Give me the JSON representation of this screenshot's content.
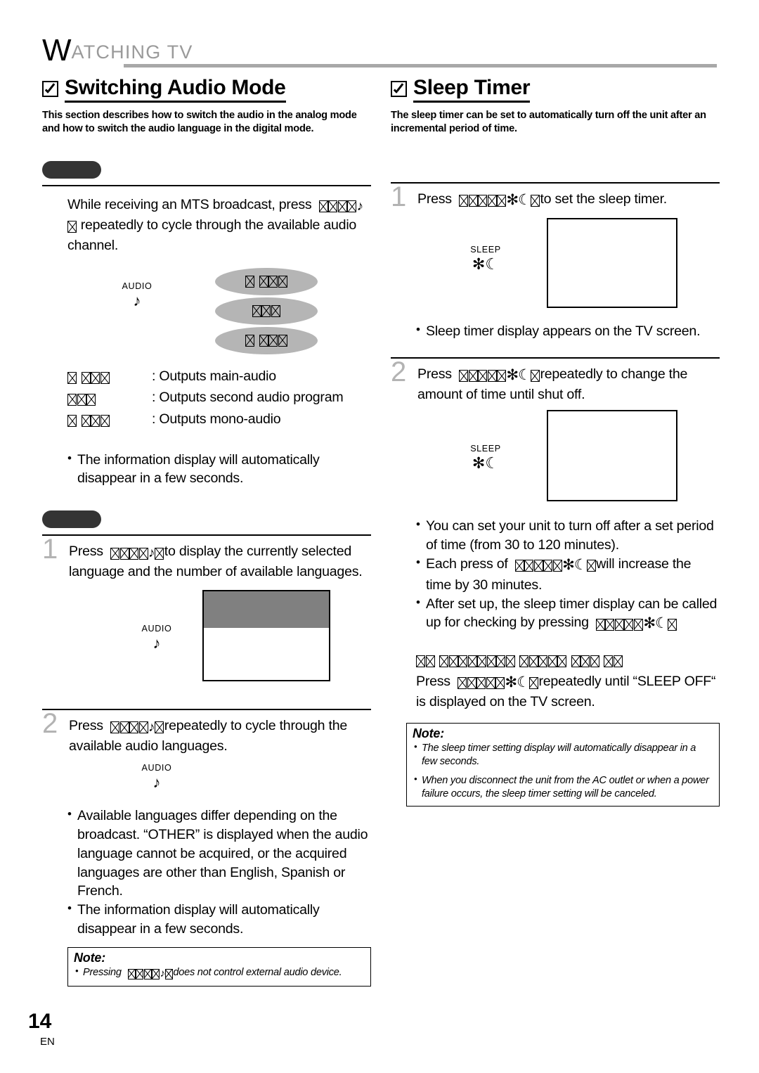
{
  "running_head": {
    "first_letter": "W",
    "rest": "ATCHING  TV"
  },
  "left_column": {
    "section": {
      "title": "Switching Audio Mode",
      "description": "This section describes how to switch the audio in the analog mode and how to switch the audio language in the digital mode."
    },
    "analog": {
      "tab_label": "",
      "intro_before": "While receiving an MTS broadcast, press",
      "intro_after": "repeatedly to cycle through the available audio channel.",
      "remote_key": {
        "label": "AUDIO",
        "icon": "♪"
      },
      "options": [
        {
          "boxes": 4,
          "gap_after": 1
        },
        {
          "boxes": 3,
          "gap_after": 0
        },
        {
          "boxes": 4,
          "gap_after": 1
        }
      ],
      "legend": [
        {
          "boxes": 4,
          "text": ": Outputs main-audio"
        },
        {
          "boxes": 3,
          "text": ": Outputs second audio program"
        },
        {
          "boxes": 4,
          "text": ": Outputs mono-audio"
        }
      ],
      "bullet": "The information display will automatically disappear in a few seconds."
    },
    "digital": {
      "tab_label": "",
      "step1": {
        "number": "1",
        "before": "Press",
        "after": "to display the currently selected language and the number of available languages.",
        "remote_key": {
          "label": "AUDIO",
          "icon": "♪"
        }
      },
      "step2": {
        "number": "2",
        "before": "Press",
        "after": "repeatedly to cycle through the available audio languages.",
        "remote_key": {
          "label": "AUDIO",
          "icon": "♪"
        }
      },
      "bullets": [
        "Available languages differ depending on the broadcast. “OTHER” is displayed when the audio language cannot be acquired, or the acquired languages are other than English, Spanish or French.",
        "The information display will automatically disappear in a few seconds."
      ],
      "note": {
        "title": "Note:",
        "items_before": "Pressing",
        "items_after": "does not control external audio device."
      }
    }
  },
  "right_column": {
    "section": {
      "title": "Sleep Timer",
      "description": "The sleep timer can be set to automatically turn off the unit after an incremental period of time."
    },
    "step1": {
      "number": "1",
      "before": "Press",
      "after": "to set the sleep timer.",
      "remote_key": {
        "label": "SLEEP",
        "icon": "✻☾"
      },
      "bullet": "Sleep timer display appears on the TV screen."
    },
    "step2": {
      "number": "2",
      "before": "Press",
      "after": "repeatedly to change the amount of time until shut off.",
      "remote_key": {
        "label": "SLEEP",
        "icon": "✻☾"
      }
    },
    "bullets": [
      {
        "text": "You can set your unit to turn off after a set period of time (from 30 to 120 minutes)."
      },
      {
        "before": "Each press of",
        "after": "will increase the time by 30 minutes."
      },
      {
        "before": "After set up, the sleep timer display can be called up for checking by pressing",
        "after": ""
      }
    ],
    "cancel": {
      "heading_groups": [
        2,
        8,
        5,
        3,
        2
      ],
      "before": "Press",
      "after": "repeatedly until “SLEEP OFF“ is displayed on the TV screen."
    },
    "note": {
      "title": "Note:",
      "items": [
        "The sleep timer setting display will automatically disappear in a few seconds.",
        "When you disconnect the unit from the AC outlet or when a power failure occurs, the sleep timer setting will be canceled."
      ]
    }
  },
  "footer": {
    "page_number": "14",
    "language": "EN"
  }
}
